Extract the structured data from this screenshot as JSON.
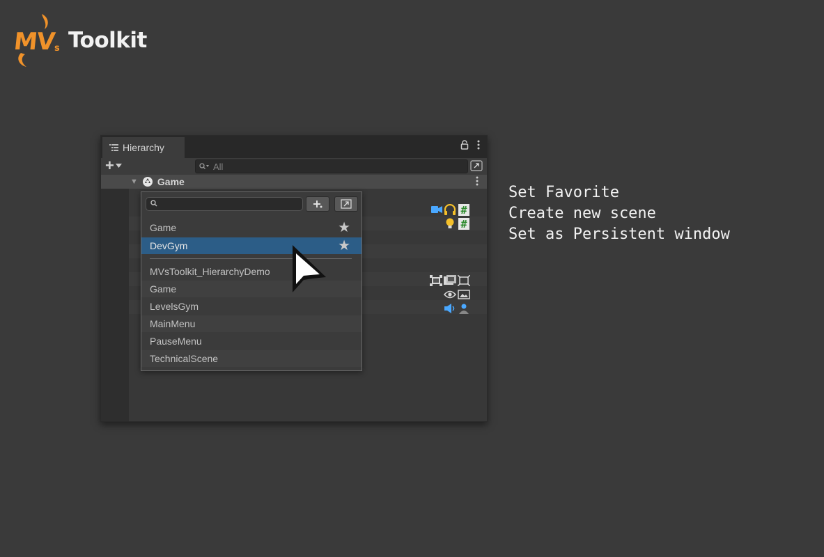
{
  "logo": {
    "mv": "MV",
    "s": "s",
    "toolkit": "Toolkit"
  },
  "hierarchy": {
    "tab_label": "Hierarchy",
    "search_placeholder": "All",
    "scene_name": "Game"
  },
  "scene_popup": {
    "favorites": [
      {
        "label": "Game",
        "starred": true
      },
      {
        "label": "DevGym",
        "starred": true,
        "selected": true
      }
    ],
    "scenes": [
      {
        "label": "MVsToolkit_HierarchyDemo"
      },
      {
        "label": "Game"
      },
      {
        "label": "LevelsGym"
      },
      {
        "label": "MainMenu"
      },
      {
        "label": "PauseMenu"
      },
      {
        "label": "TechnicalScene"
      }
    ],
    "star_glyph": "★"
  },
  "notes": [
    "Set Favorite",
    "Create new scene",
    "Set as Persistent window"
  ],
  "colors": {
    "background": "#3a3a3a",
    "logo_orange": "#f0922a",
    "selection": "#2c5d87",
    "camera_blue": "#4aa8ff",
    "audio_yellow": "#f5c02a",
    "script_green": "#7bc47f"
  },
  "icons": [
    "hierarchy-list-icon",
    "lock-icon",
    "more-icon",
    "plus-icon",
    "chevron-down-icon",
    "search-icon",
    "maximize-icon",
    "unity-scene-icon",
    "camera-icon",
    "headphones-icon",
    "script-icon",
    "light-bulb-icon",
    "rect-transform-icon",
    "image-icon",
    "canvas-icon",
    "eye-icon",
    "raw-image-icon",
    "audio-source-icon",
    "player-icon",
    "cursor-icon"
  ]
}
